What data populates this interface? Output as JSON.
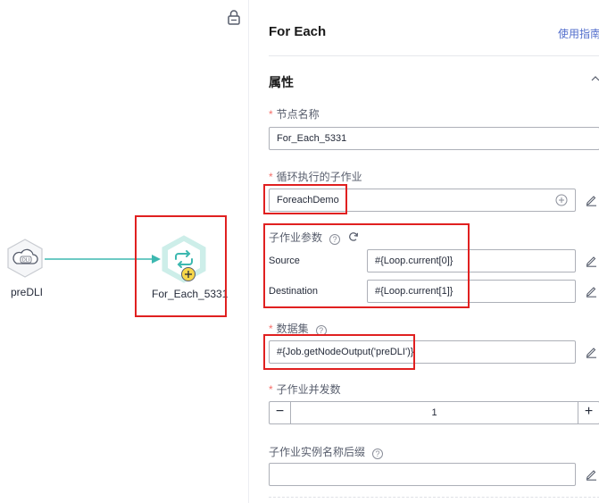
{
  "canvas": {
    "nodes": [
      {
        "label": "preDLI",
        "badge": "DLI"
      },
      {
        "label": "For_Each_5331"
      }
    ]
  },
  "panel": {
    "title": "For Each",
    "guide_link": "使用指南",
    "section_title": "属性",
    "fields": {
      "node_name": {
        "label": "节点名称",
        "required_mark": "*",
        "value": "For_Each_5331"
      },
      "sub_job": {
        "label": "循环执行的子作业",
        "required_mark": "*",
        "value": "ForeachDemo"
      },
      "sub_job_params": {
        "label": "子作业参数",
        "help": "?",
        "rows": [
          {
            "name": "Source",
            "value": "#{Loop.current[0]}"
          },
          {
            "name": "Destination",
            "value": "#{Loop.current[1]}"
          }
        ]
      },
      "dataset": {
        "label": "数据集",
        "required_mark": "*",
        "help": "?",
        "value": "#{Job.getNodeOutput('preDLI')}"
      },
      "concurrency": {
        "label": "子作业并发数",
        "required_mark": "*",
        "value": "1",
        "minus": "−",
        "plus": "+"
      },
      "instance_suffix": {
        "label": "子作业实例名称后缀",
        "help": "?",
        "value": ""
      }
    }
  },
  "colors": {
    "accent_teal": "#3db8b0",
    "node_ring": "#cdeee9",
    "highlight_red": "#e02020",
    "link_blue": "#526ecc",
    "required_red": "#f66f6a"
  },
  "icons": [
    "lock-icon",
    "cloud-icon",
    "loop-icon",
    "add-circle-icon",
    "edit-icon",
    "refresh-icon",
    "help-icon",
    "chevron-up-icon"
  ]
}
